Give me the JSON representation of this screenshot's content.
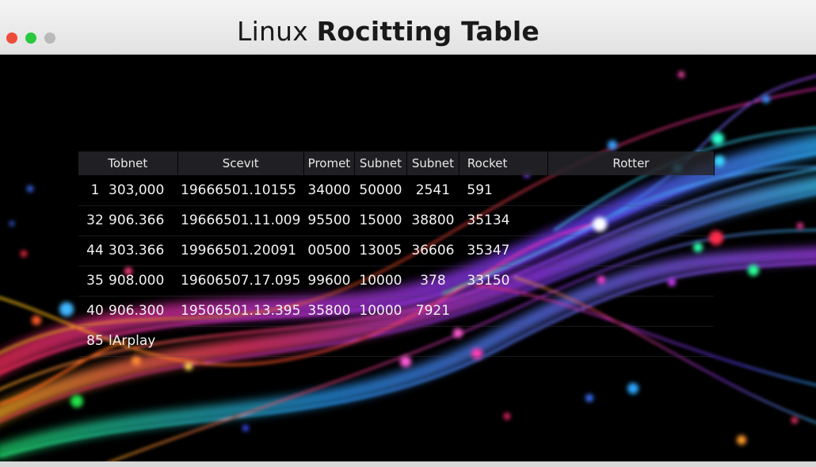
{
  "window": {
    "title_prefix": "Linux",
    "title_bold": "Rocitting Table"
  },
  "table": {
    "headers": [
      "Tobnet",
      "Scevıt",
      "Promet",
      "Subnet",
      "Subnet",
      "Rocket",
      "Rotter"
    ],
    "rows": [
      [
        "1",
        "303,000",
        "19666501.10155",
        "34000",
        "50000",
        "2541",
        "591"
      ],
      [
        "32",
        "906.366",
        "19666501.11.009",
        "95500",
        "15000",
        "38800",
        "35134"
      ],
      [
        "44",
        "303.366",
        "19966501.20091",
        "00500",
        "13005",
        "36606",
        "35347"
      ],
      [
        "35",
        "908.000",
        "19606507.17.095",
        "99600",
        "10000",
        "378",
        "33150"
      ],
      [
        "40",
        "906.300",
        "19506501.13.395",
        "35800",
        "10000",
        "7921",
        ""
      ],
      [
        "85",
        "lArplay",
        "",
        "",
        "",
        "",
        ""
      ]
    ]
  },
  "colors": {
    "titlebar": "#ececec",
    "background": "#000000",
    "close": "#ee4b3a",
    "minimize": "#27c93f",
    "maximize": "#b9b9b9"
  }
}
